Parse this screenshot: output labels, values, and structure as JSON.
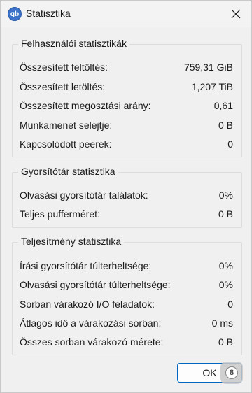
{
  "window": {
    "title": "Statisztika",
    "icon_text": "qb",
    "close_icon": "close-icon"
  },
  "user_stats": {
    "title": "Felhasználói statisztikák",
    "rows": [
      {
        "label": "Összesített feltöltés:",
        "value": "759,31 GiB"
      },
      {
        "label": "Összesített letöltés:",
        "value": "1,207 TiB"
      },
      {
        "label": "Összesített megosztási arány:",
        "value": "0,61"
      },
      {
        "label": "Munkamenet selejtje:",
        "value": "0 B"
      },
      {
        "label": "Kapcsolódott peerek:",
        "value": "0"
      }
    ]
  },
  "cache_stats": {
    "title": "Gyorsítótár statisztika",
    "rows": [
      {
        "label": "Olvasási gyorsítótár találatok:",
        "value": "0%"
      },
      {
        "label": "Teljes pufferméret:",
        "value": "0 B"
      }
    ]
  },
  "perf_stats": {
    "title": "Teljesítmény statisztika",
    "rows": [
      {
        "label": "Írási gyorsítótár túlterheltsége:",
        "value": "0%"
      },
      {
        "label": "Olvasási gyorsítótár túlterheltsége:",
        "value": "0%"
      },
      {
        "label": "Sorban várakozó I/O feladatok:",
        "value": "0"
      },
      {
        "label": "Átlagos idő a várakozási sorban:",
        "value": "0 ms"
      },
      {
        "label": "Összes sorban várakozó mérete:",
        "value": "0 B"
      }
    ]
  },
  "buttons": {
    "ok_label": "OK"
  },
  "colors": {
    "accent": "#0067c0",
    "background": "#f0f0f0"
  }
}
